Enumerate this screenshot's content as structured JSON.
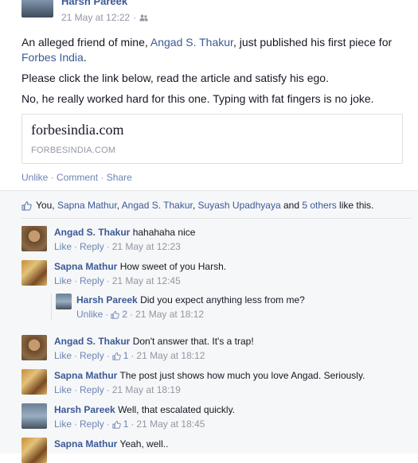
{
  "post": {
    "author": "Harsh Pareek",
    "timestamp": "21 May at 12:22",
    "separator": "·",
    "audience_icon": "friends-icon",
    "body": {
      "p1_pre": "An alleged friend of mine, ",
      "p1_link": "Angad S. Thakur",
      "p1_mid": ", just published his first piece for ",
      "p1_link2": "Forbes India",
      "p1_post": ".",
      "p2": "Please click the link below, read the article and satisfy his ego.",
      "p3": "No, he really worked hard for this one. Typing with fat fingers is no joke."
    },
    "link_card": {
      "title": "forbesindia.com",
      "domain": "FORBESINDIA.COM"
    },
    "actions": {
      "unlike": "Unlike",
      "comment": "Comment",
      "share": "Share",
      "sep": " · "
    }
  },
  "likes": {
    "you": "You,",
    "names": [
      "Sapna Mathur",
      "Angad S. Thakur",
      "Suyash Upadhyaya"
    ],
    "and": "and",
    "others": "5 others",
    "suffix": "like this.",
    "comma": ","
  },
  "comments": [
    {
      "name": "Angad S. Thakur",
      "text": "hahahaha nice",
      "action": "Like",
      "reply": "Reply",
      "likes": "",
      "time": "21 May at 12:23"
    },
    {
      "name": "Sapna Mathur",
      "text": "How sweet of you Harsh.",
      "action": "Like",
      "reply": "Reply",
      "likes": "",
      "time": "21 May at 12:45"
    },
    {
      "name": "Angad S. Thakur",
      "text": "Don't answer that. It's a trap!",
      "action": "Like",
      "reply": "Reply",
      "likes": "1",
      "time": "21 May at 18:12"
    },
    {
      "name": "Sapna Mathur",
      "text": "The post just shows how much you love Angad. Seriously.",
      "action": "Like",
      "reply": "Reply",
      "likes": "",
      "time": "21 May at 18:19"
    },
    {
      "name": "Harsh Pareek",
      "text": "Well, that escalated quickly.",
      "action": "Like",
      "reply": "Reply",
      "likes": "1",
      "time": "21 May at 18:45"
    },
    {
      "name": "Sapna Mathur",
      "text": "Yeah, well.."
    }
  ],
  "reply": {
    "name": "Harsh Pareek",
    "text": "Did you expect anything less from me?",
    "action": "Unlike",
    "likes": "2",
    "time": "21 May at 18:12"
  },
  "dot": "·",
  "colors": {
    "link": "#3b5998",
    "muted": "#9197a3",
    "ufi_bg": "#f6f7f8"
  }
}
